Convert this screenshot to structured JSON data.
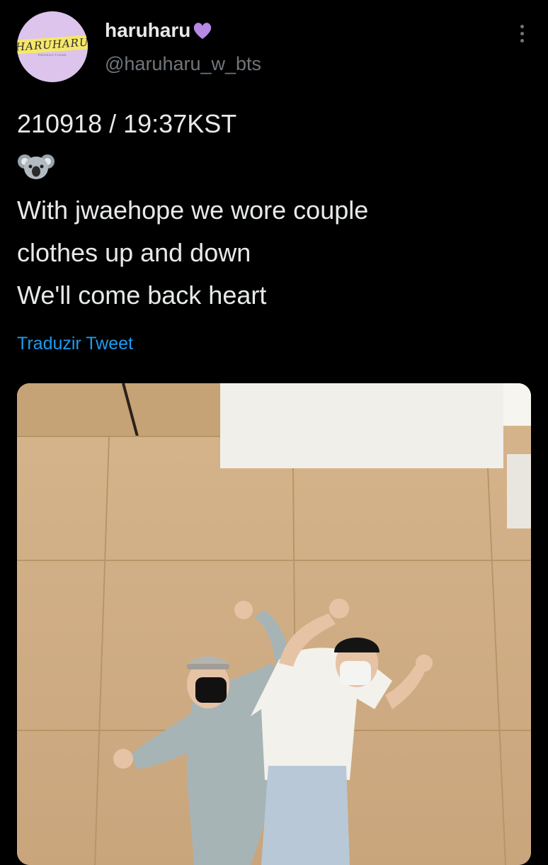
{
  "tweet": {
    "avatar": {
      "text": "HARUHARU",
      "subtext": "PRODUCTIONS",
      "bg_color": "#dcc4ec"
    },
    "author": {
      "display_name": "haruharu",
      "emoji": "purple-heart-icon",
      "handle": "@haruharu_w_bts"
    },
    "lines": [
      "210918 / 19:37KST",
      "With jwaehope we wore couple",
      "clothes up and down",
      "We'll come back heart"
    ],
    "emoji_line": "koala-icon",
    "translate_label": "Traduzir Tweet",
    "media": {
      "kind": "photo"
    }
  },
  "colors": {
    "background": "#000000",
    "text": "#e7e9ea",
    "secondary": "#71767b",
    "link": "#1d9bf0",
    "heart": "#b589e4"
  }
}
